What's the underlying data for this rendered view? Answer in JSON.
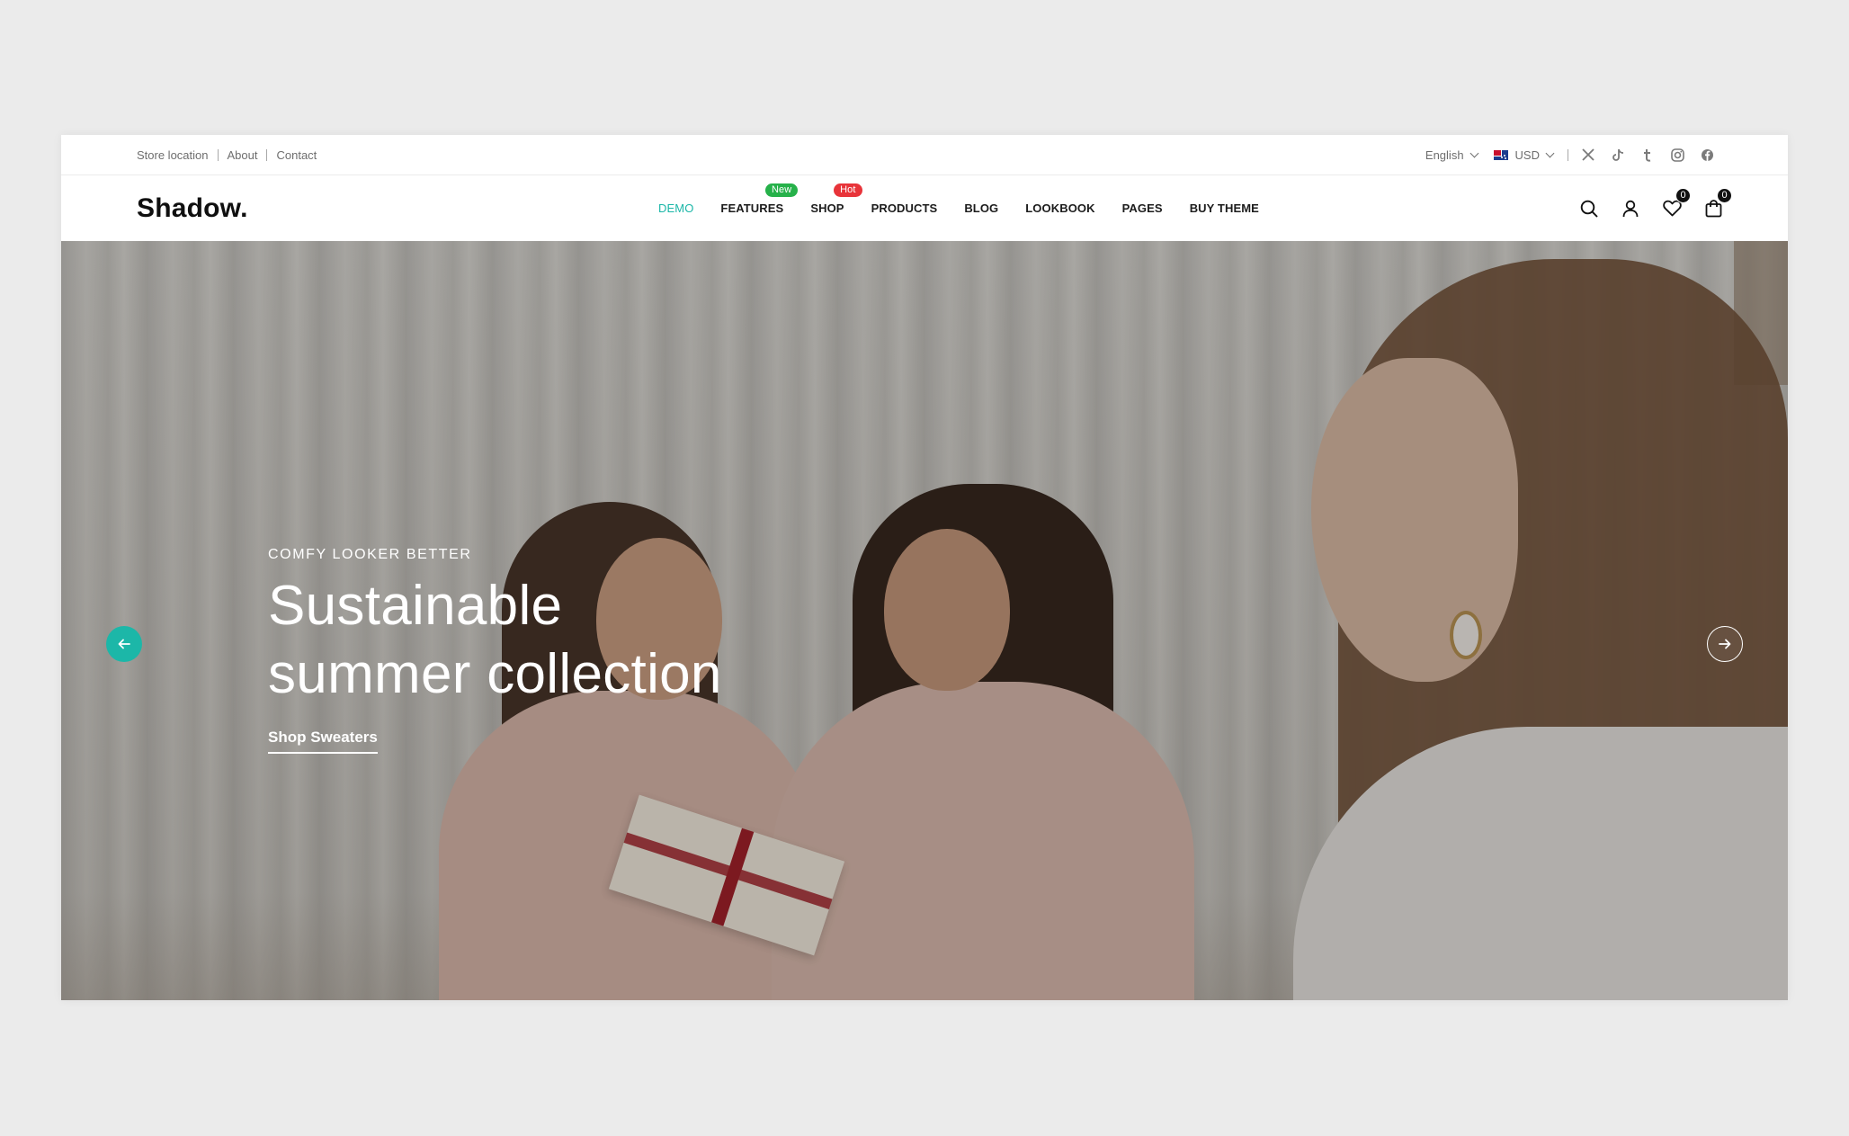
{
  "topbar": {
    "links": [
      "Store location",
      "About",
      "Contact"
    ],
    "language": "English",
    "currency": "USD",
    "social_icons": [
      "x-icon",
      "tiktok-icon",
      "tumblr-icon",
      "instagram-icon",
      "facebook-icon"
    ]
  },
  "header": {
    "logo": "Shadow.",
    "nav": [
      {
        "label": "DEMO",
        "active": true
      },
      {
        "label": "FEATURES",
        "badge": "New"
      },
      {
        "label": "SHOP",
        "badge": "Hot"
      },
      {
        "label": "PRODUCTS"
      },
      {
        "label": "BLOG"
      },
      {
        "label": "LOOKBOOK"
      },
      {
        "label": "PAGES"
      },
      {
        "label": "BUY THEME"
      }
    ],
    "wishlist_count": "0",
    "cart_count": "0"
  },
  "hero": {
    "eyebrow": "COMFY LOOKER BETTER",
    "headline_line1": "Sustainable",
    "headline_line2": "summer collection",
    "cta": "Shop Sweaters"
  },
  "colors": {
    "accent": "#1cb7a8",
    "badge_new": "#26b14a",
    "badge_hot": "#e8343a"
  }
}
